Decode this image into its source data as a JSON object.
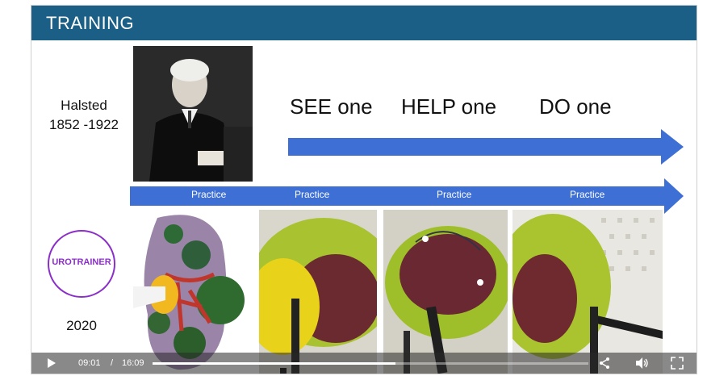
{
  "slide": {
    "title": "TRAINING",
    "halsted_name": "Halsted",
    "halsted_years": "1852 -1922",
    "steps": [
      "SEE one",
      "HELP one",
      "DO one"
    ],
    "practice_labels": [
      "Practice",
      "Practice",
      "Practice",
      "Practice"
    ],
    "logo_text": "UROTRAINER",
    "year": "2020"
  },
  "player": {
    "current_time": "09:01",
    "separator": "/",
    "duration": "16:09",
    "progress": 0.558
  },
  "colors": {
    "title_bar": "#1b5f86",
    "arrow": "#3d6fd4",
    "logo": "#8b2fc9"
  }
}
